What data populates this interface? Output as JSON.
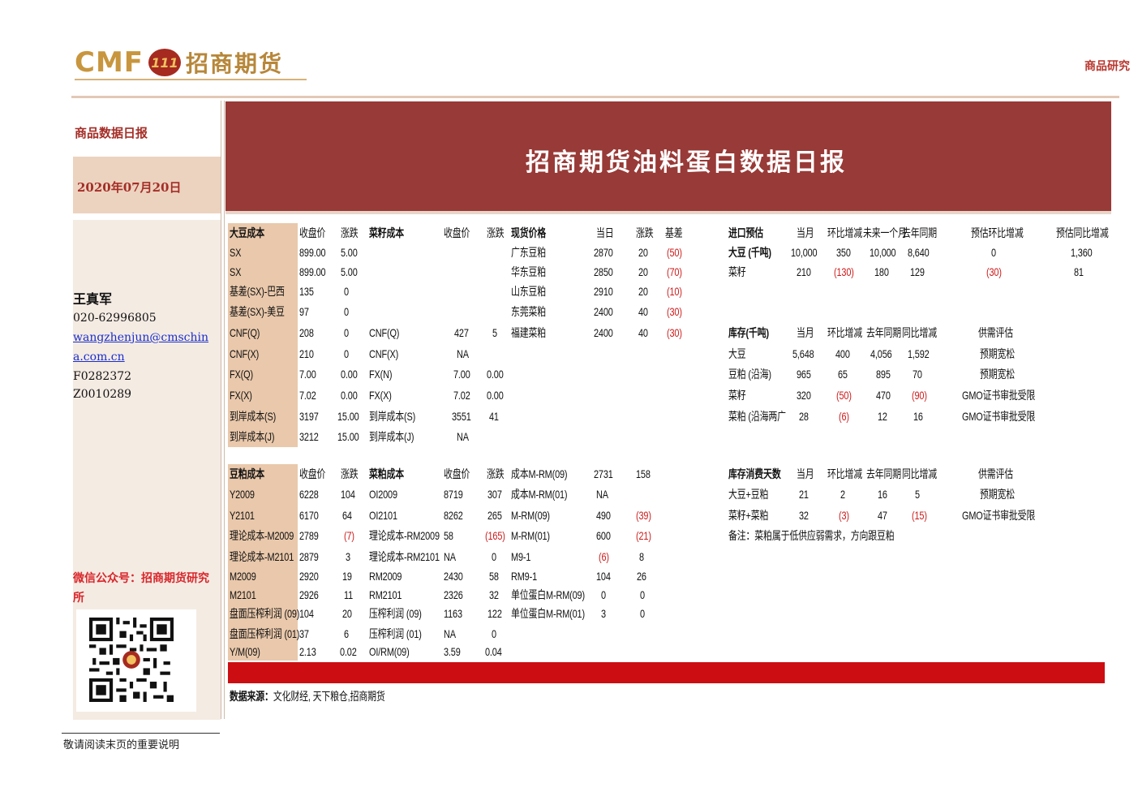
{
  "header": {
    "logo_en": "CMF",
    "logo_mark": "111",
    "logo_cn": "招商期货",
    "right_label": "商品研究"
  },
  "sidebar": {
    "report_type": "商品数据日报",
    "date": "2020年07月20日",
    "author": "王真军",
    "phone": "020-62996805",
    "email_line1": "wangzhenjun@cmschin",
    "email_line2": "a.com.cn",
    "license1": "F0282372",
    "license2": "Z0010289",
    "wechat": "微信公众号：招商期货研究所"
  },
  "banner": {
    "title": "招商期货油料蛋白数据日报"
  },
  "tag": "",
  "tables": {
    "soy_cost": {
      "headers": [
        "大豆成本",
        "收盘价",
        "涨跌"
      ],
      "rows": [
        [
          "SX",
          "899.00",
          "5.00"
        ],
        [
          "SX",
          "899.00",
          "5.00"
        ],
        [
          "基差(SX)-巴西",
          "135",
          "0"
        ],
        [
          "基差(SX)-美豆",
          "97",
          "0"
        ],
        [
          "CNF(Q)",
          "208",
          "0"
        ],
        [
          "CNF(X)",
          "210",
          "0"
        ],
        [
          "FX(Q)",
          "7.00",
          "0.00"
        ],
        [
          "FX(X)",
          "7.02",
          "0.00"
        ],
        [
          "到岸成本(S)",
          "3197",
          "15.00"
        ],
        [
          "到岸成本(J)",
          "3212",
          "15.00"
        ]
      ]
    },
    "rapeseed_cost": {
      "headers": [
        "菜籽成本",
        "收盘价",
        "涨跌"
      ],
      "rows": [
        [
          "CNF(Q)",
          "427",
          "5"
        ],
        [
          "CNF(X)",
          "NA",
          ""
        ],
        [
          "FX(N)",
          "7.00",
          "0.00"
        ],
        [
          "FX(X)",
          "7.02",
          "0.00"
        ],
        [
          "到岸成本(S)",
          "3551",
          "41"
        ],
        [
          "到岸成本(J)",
          "NA",
          ""
        ]
      ]
    },
    "spot": {
      "headers": [
        "现货价格",
        "当日",
        "涨跌",
        "基差"
      ],
      "rows": [
        [
          "广东豆粕",
          "2870",
          "20",
          "(50)"
        ],
        [
          "华东豆粕",
          "2850",
          "20",
          "(70)"
        ],
        [
          "山东豆粕",
          "2910",
          "20",
          "(10)"
        ],
        [
          "东莞菜粕",
          "2400",
          "40",
          "(30)"
        ],
        [
          "福建菜粕",
          "2400",
          "40",
          "(30)"
        ]
      ]
    },
    "import": {
      "headers": [
        "进口预估",
        "当月",
        "环比增减",
        "未来一个月",
        "去年同期",
        "预估环比增减",
        "预估同比增减"
      ],
      "rows": [
        [
          "大豆 (千吨)",
          "10,000",
          "350",
          "10,000",
          "8,640",
          "0",
          "1,360"
        ],
        [
          "菜籽",
          "210",
          "(130)",
          "180",
          "129",
          "(30)",
          "81"
        ]
      ]
    },
    "inventory": {
      "headers": [
        "库存(千吨)",
        "当月",
        "环比增减",
        "去年同期",
        "同比增减",
        "供需评估"
      ],
      "rows": [
        [
          "大豆",
          "5,648",
          "400",
          "4,056",
          "1,592",
          "预期宽松"
        ],
        [
          "豆粕 (沿海)",
          "965",
          "65",
          "895",
          "70",
          "预期宽松"
        ],
        [
          "菜籽",
          "320",
          "(50)",
          "470",
          "(90)",
          "GMO证书审批受限"
        ],
        [
          "菜粕 (沿海两广",
          "28",
          "(6)",
          "12",
          "16",
          "GMO证书审批受限"
        ]
      ]
    },
    "meal_cost": {
      "headers": [
        "豆粕成本",
        "收盘价",
        "涨跌"
      ],
      "rows": [
        [
          "Y2009",
          "6228",
          "104"
        ],
        [
          "Y2101",
          "6170",
          "64"
        ],
        [
          "理论成本-M2009",
          "2789",
          "(7)"
        ],
        [
          "理论成本-M2101",
          "2879",
          "3"
        ],
        [
          "M2009",
          "2920",
          "19"
        ],
        [
          "M2101",
          "2926",
          "11"
        ],
        [
          "盘面压榨利润 (09)",
          "104",
          "20"
        ],
        [
          "盘面压榨利润 (01)",
          "37",
          "6"
        ],
        [
          "Y/M(09)",
          "2.13",
          "0.02"
        ]
      ]
    },
    "rapemeal_cost": {
      "headers": [
        "菜粕成本",
        "收盘价",
        "涨跌"
      ],
      "rows": [
        [
          "OI2009",
          "8719",
          "307"
        ],
        [
          "OI2101",
          "8262",
          "265"
        ],
        [
          "理论成本-RM2009",
          "58",
          "(165)"
        ],
        [
          "理论成本-RM2101",
          "NA",
          "0"
        ],
        [
          "RM2009",
          "2430",
          "58"
        ],
        [
          "RM2101",
          "2326",
          "32"
        ],
        [
          "压榨利润 (09)",
          "1163",
          "122"
        ],
        [
          "压榨利润 (01)",
          "NA",
          "0"
        ],
        [
          "OI/RM(09)",
          "3.59",
          "0.04"
        ]
      ]
    },
    "spreads": {
      "rows": [
        [
          "成本M-RM(09)",
          "2731",
          "158"
        ],
        [
          "成本M-RM(01)",
          "NA",
          ""
        ],
        [
          "M-RM(09)",
          "490",
          "(39)"
        ],
        [
          "M-RM(01)",
          "600",
          "(21)"
        ],
        [
          "M9-1",
          "(6)",
          "8"
        ],
        [
          "RM9-1",
          "104",
          "26"
        ],
        [
          "单位蛋白M-RM(09)",
          "0",
          "0"
        ],
        [
          "单位蛋白M-RM(01)",
          "3",
          "0"
        ]
      ]
    },
    "days": {
      "headers": [
        "库存消费天数",
        "当月",
        "环比增减",
        "去年同期",
        "同比增减",
        "供需评估"
      ],
      "rows": [
        [
          "大豆+豆粕",
          "21",
          "2",
          "16",
          "5",
          "预期宽松"
        ],
        [
          "菜籽+菜粕",
          "32",
          "(3)",
          "47",
          "(15)",
          "GMO证书审批受限"
        ]
      ],
      "note": "备注：菜粕属于低供应弱需求，方向跟豆粕"
    }
  },
  "source_label": "数据来源：",
  "source_text": "文化财经, 天下粮仓,招商期货",
  "bottom_note": "敬请阅读末页的重要说明",
  "colors": {
    "banner": "#983a37",
    "accent_red": "#cc0e12",
    "negative": "#cc1b1b",
    "highlight": "#e9c8ab"
  }
}
